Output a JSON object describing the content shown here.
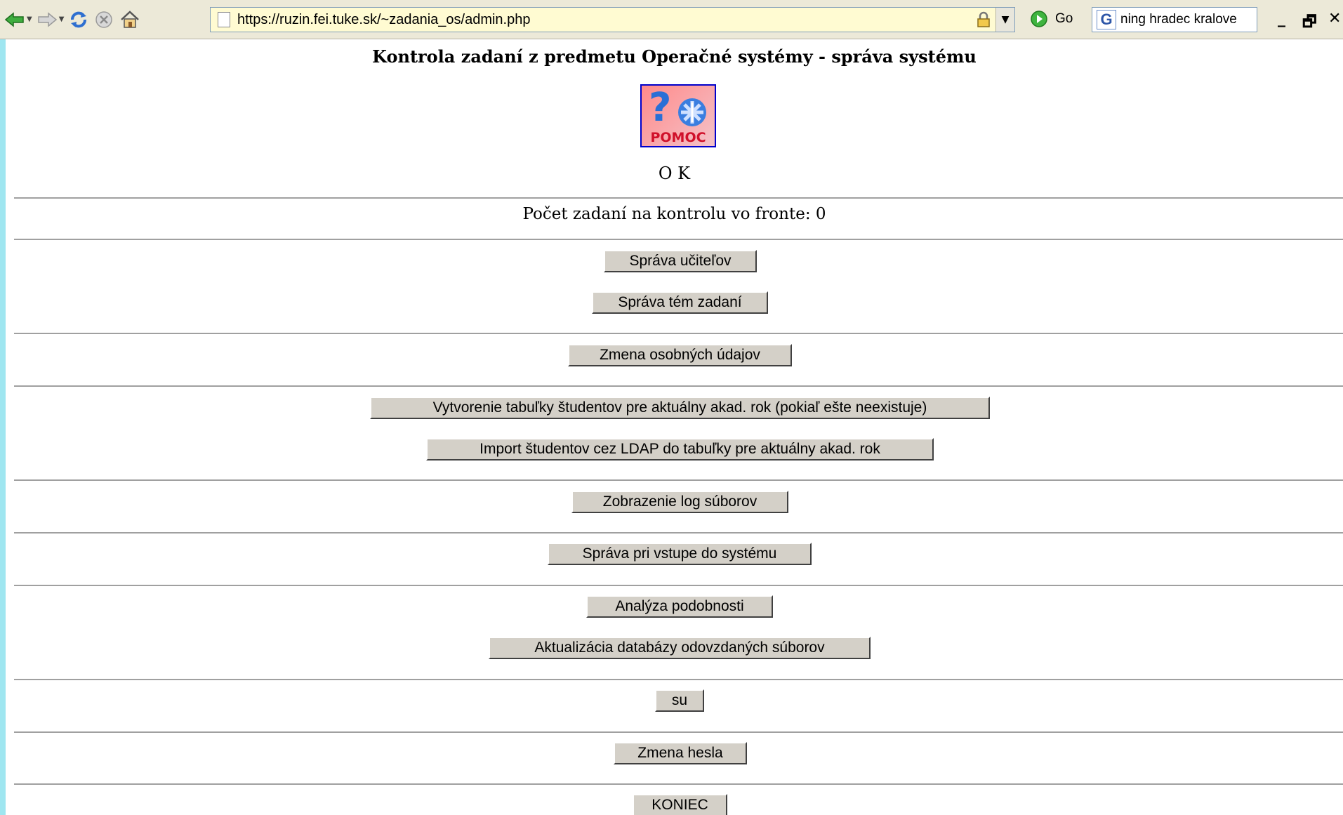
{
  "browser": {
    "url": "https://ruzin.fei.tuke.sk/~zadania_os/admin.php",
    "go_label": "Go",
    "search_value": "ning hradec kralove"
  },
  "page": {
    "title": "Kontrola zadaní z predmetu Operačné systémy - správa systému",
    "help_image_text": "POMOC",
    "status": "O K",
    "queue_text": "Počet zadaní na kontrolu vo fronte: 0"
  },
  "buttons": {
    "teachers": "Správa učiteľov",
    "topics": "Správa tém zadaní",
    "personal": "Zmena osobných údajov",
    "create_table": "Vytvorenie tabuľky študentov pre aktuálny akad. rok (pokiaľ ešte neexistuje)",
    "ldap_import": "Import študentov cez LDAP do tabuľky pre aktuálny akad. rok",
    "logs": "Zobrazenie log súborov",
    "login_msg": "Správa pri vstupe do systému",
    "similarity": "Analýza podobnosti",
    "db_update": "Aktualizácia databázy odovzdaných súborov",
    "su": "su",
    "password": "Zmena hesla",
    "end": "KONIEC"
  }
}
